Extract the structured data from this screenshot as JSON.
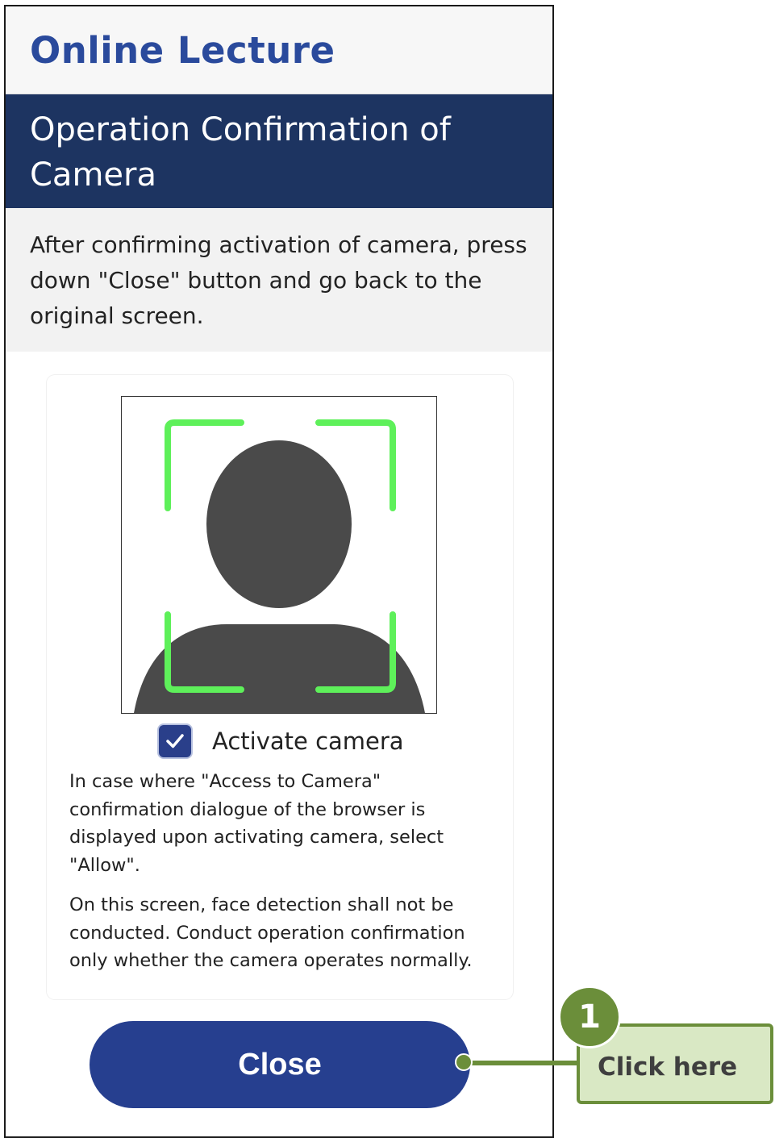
{
  "header": {
    "title": "Online Lecture"
  },
  "section": {
    "title": "Operation Confirmation of Camera"
  },
  "instruction": {
    "text": "After confirming activation of camera, press down \"Close\" button and go back to the original screen."
  },
  "camera": {
    "preview_icon": "person-placeholder-icon",
    "frame_icon": "face-detection-frame-icon",
    "frame_color": "#5ef05a",
    "silhouette_color": "#4a4a4a"
  },
  "activate": {
    "label": "Activate camera",
    "checked": true
  },
  "notes": [
    "In case where \"Access to Camera\" confirmation dialogue of the browser is displayed upon activating camera, select \"Allow\".",
    "On this screen, face detection shall not be conducted. Conduct operation confirmation only whether the camera operates normally."
  ],
  "close_button": {
    "label": "Close",
    "color": "#263f8f"
  },
  "annotation": {
    "step": "1",
    "label": "Click here",
    "color": "#6b8e3a"
  }
}
